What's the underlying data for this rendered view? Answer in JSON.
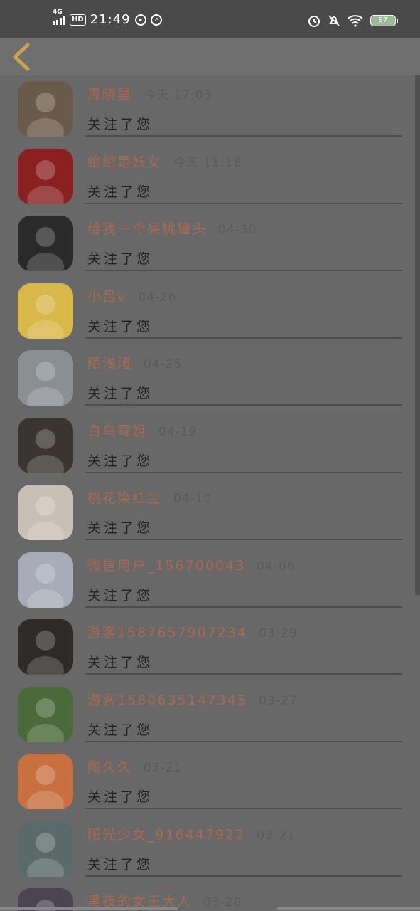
{
  "status_bar": {
    "network": "4G",
    "hd": "HD",
    "time": "21:49",
    "battery": "97",
    "icons": [
      "signal-icon",
      "hd-icon",
      "gallery-icon",
      "speed-icon",
      "alarm-icon",
      "mute-icon",
      "wifi-icon",
      "battery-icon"
    ]
  },
  "header": {
    "back_icon": "chevron-left-icon",
    "accent": "#c8a54a"
  },
  "followers": [
    {
      "name": "周晓曼",
      "date": "今天 17:03",
      "action": "关注了您",
      "avatar_color": "#6a5a4a"
    },
    {
      "name": "绾绾是妖女",
      "date": "今天 11:18",
      "action": "关注了您",
      "avatar_color": "#8a2020"
    },
    {
      "name": "给我一个呆桃罐头",
      "date": "04-30",
      "action": "关注了您",
      "avatar_color": "#2a2a2a"
    },
    {
      "name": "小吕v",
      "date": "04-26",
      "action": "关注了您",
      "avatar_color": "#d9b84a"
    },
    {
      "name": "陌浅渚",
      "date": "04-25",
      "action": "关注了您",
      "avatar_color": "#8a8f94"
    },
    {
      "name": "白鸟雪姐",
      "date": "04-19",
      "action": "关注了您",
      "avatar_color": "#3a3530"
    },
    {
      "name": "桃花染红尘",
      "date": "04-10",
      "action": "关注了您",
      "avatar_color": "#c8c0b5"
    },
    {
      "name": "微信用户_156700043",
      "date": "04-06",
      "action": "关注了您",
      "avatar_color": "#a8acb8"
    },
    {
      "name": "游客1587657907234",
      "date": "03-29",
      "action": "关注了您",
      "avatar_color": "#2e2a28"
    },
    {
      "name": "游客1580635147345",
      "date": "03-27",
      "action": "关注了您",
      "avatar_color": "#4a6a3a"
    },
    {
      "name": "陶久久",
      "date": "03-21",
      "action": "关注了您",
      "avatar_color": "#c87040"
    },
    {
      "name": "阳光少女_916447922",
      "date": "03-21",
      "action": "关注了您",
      "avatar_color": "#5a6a6a"
    },
    {
      "name": "黑夜的女王大人",
      "date": "03-20",
      "action": "",
      "avatar_color": "#4a4550"
    }
  ]
}
